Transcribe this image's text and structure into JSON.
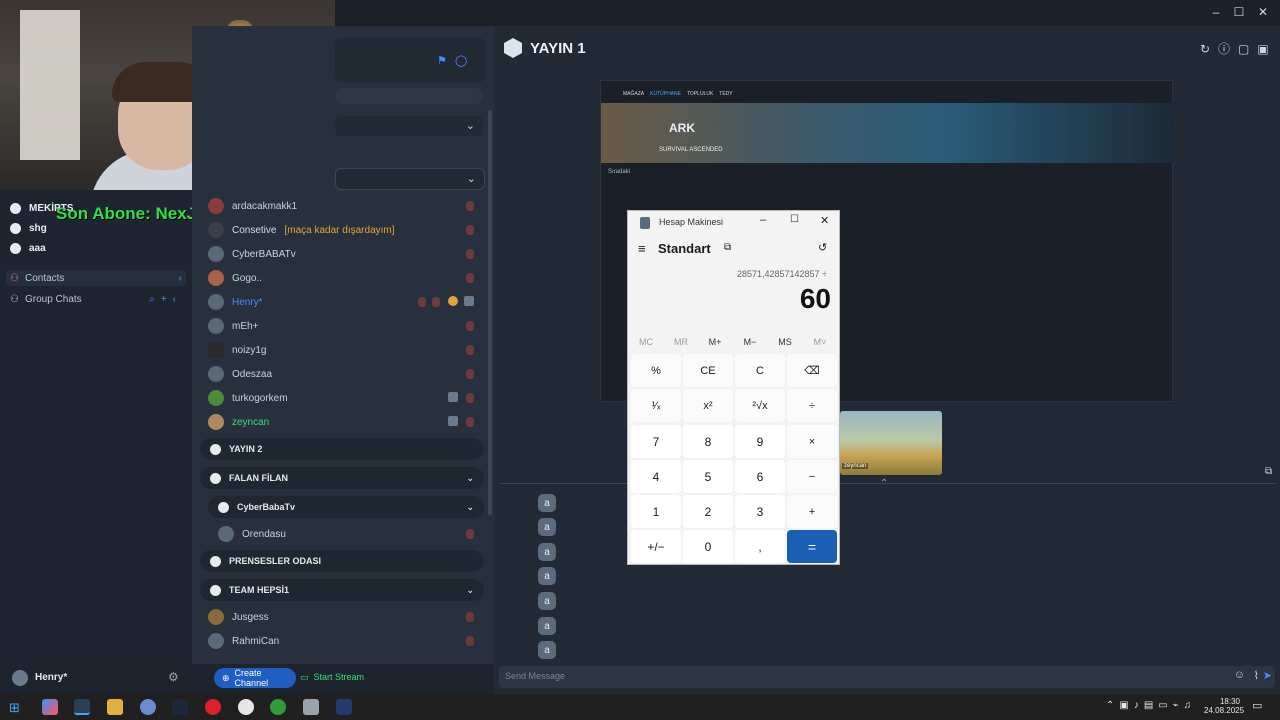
{
  "overlay": {
    "subscriber_text": "Son Abone: NexJonn"
  },
  "servers": [
    {
      "label": "MEKİPTS"
    },
    {
      "label": "shg"
    },
    {
      "label": "aaa"
    }
  ],
  "sidebar": {
    "contacts": "Contacts",
    "group_chats": "Group Chats"
  },
  "users": [
    {
      "name": "ardacakmakk1",
      "color": "#d4dbe3"
    },
    {
      "name": "Consetive",
      "note": "[maça kadar dışardayım]",
      "color": "#d4dbe3"
    },
    {
      "name": "CyberBABATv",
      "color": "#d4dbe3"
    },
    {
      "name": "Gogo..",
      "color": "#d4dbe3"
    },
    {
      "name": "Henry*",
      "color": "#4a8cff"
    },
    {
      "name": "mEh+",
      "color": "#d4dbe3"
    },
    {
      "name": "noizy1g",
      "color": "#d4dbe3"
    },
    {
      "name": "Odeszaa",
      "color": "#d4dbe3"
    },
    {
      "name": "turkogorkem",
      "color": "#d4dbe3"
    },
    {
      "name": "zeyncan",
      "color": "#3ddc7a"
    }
  ],
  "channels": {
    "yayin2": "YAYIN 2",
    "falan": "FALAN FİLAN",
    "cyber": "CyberBabaTv",
    "orendasu": "Orendasu",
    "prenses": "PRENSESLER ODASI",
    "team": "TEAM HEPSİ1",
    "jusgess": "Jusgess",
    "rahmican": "RahmiCan"
  },
  "bottom_bar": {
    "username": "Henry*",
    "create_channel": "Create Channel",
    "start_stream": "Start Stream",
    "message_placeholder": "Send Message"
  },
  "stream": {
    "title": "YAYIN 1",
    "preview_game": "ARK",
    "preview_subtitle": "SURVIVAL ASCENDED",
    "preview_nav": [
      "MAĞAZA",
      "KÜTÜPHANE",
      "TOPLULUK",
      "TEDY"
    ],
    "preview_queue": "Sıradaki",
    "thumb_label": "zeyncan"
  },
  "calculator": {
    "title": "Hesap Makinesi",
    "mode": "Standart",
    "expression": "28571,42857142857 ÷",
    "display": "60",
    "memory": [
      "MC",
      "MR",
      "M+",
      "M−",
      "MS",
      "M˅"
    ],
    "rows": [
      [
        "%",
        "CE",
        "C",
        "⌫"
      ],
      [
        "¹⁄ₓ",
        "x²",
        "²√x",
        "÷"
      ],
      [
        "7",
        "8",
        "9",
        "×"
      ],
      [
        "4",
        "5",
        "6",
        "−"
      ],
      [
        "1",
        "2",
        "3",
        "+"
      ],
      [
        "+/−",
        "0",
        ",",
        "="
      ]
    ]
  },
  "chat_buttons": [
    "a",
    "a",
    "a",
    "a",
    "a",
    "a",
    "a"
  ],
  "clock": {
    "time": "18:30",
    "date": "24.08.2025"
  }
}
